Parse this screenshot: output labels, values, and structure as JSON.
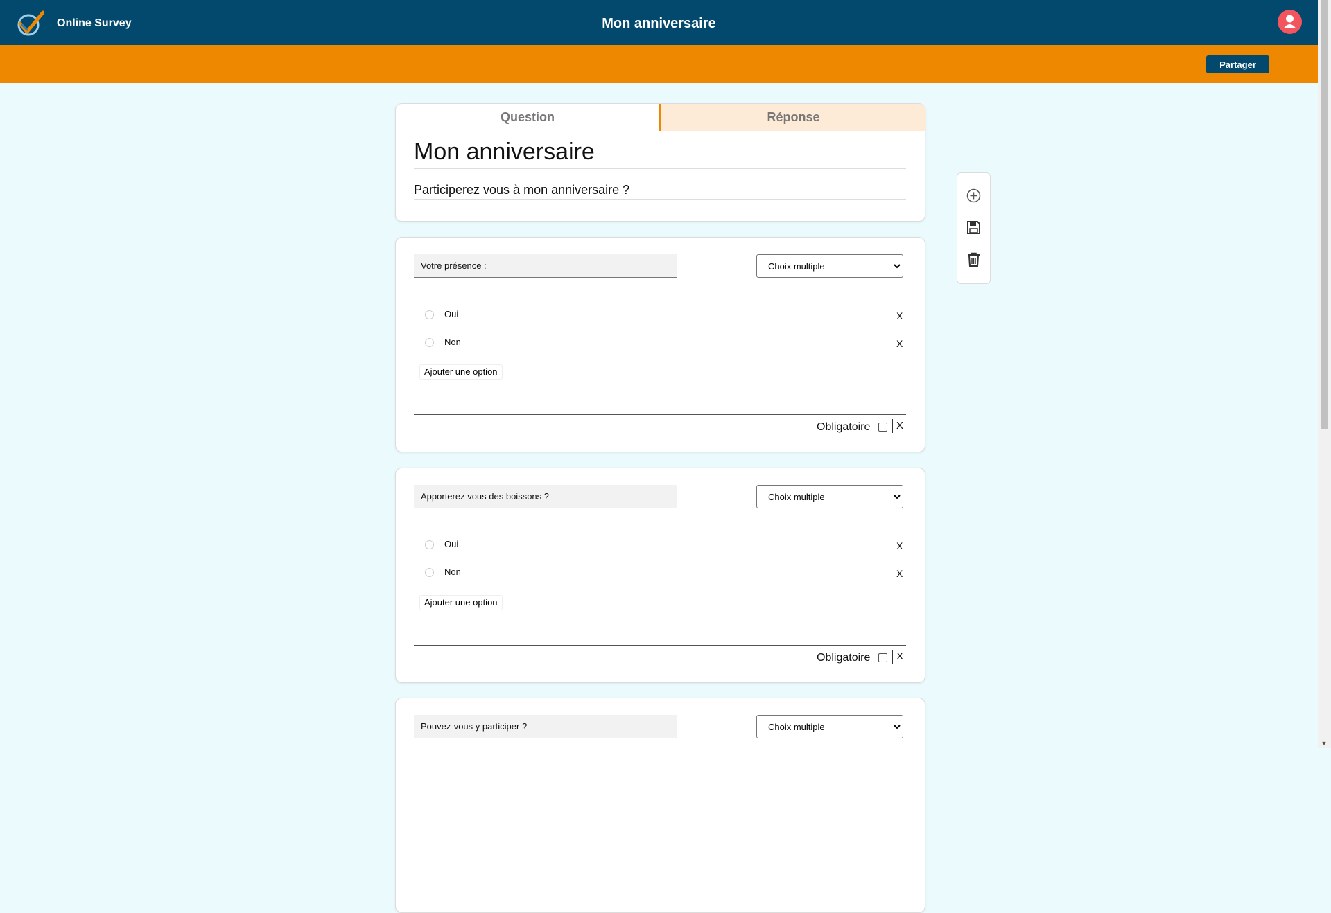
{
  "header": {
    "brand": "Online Survey",
    "title": "Mon anniversaire",
    "user_icon": "user-icon",
    "brand_colors": {
      "navy": "#03496e",
      "orange": "#ee8800",
      "avatar": "#f2555d"
    }
  },
  "actions": {
    "share_label": "Partager"
  },
  "tabs": {
    "question": "Question",
    "answer": "Réponse"
  },
  "survey": {
    "title": "Mon anniversaire",
    "description": "Participerez vous à mon anniversaire ?"
  },
  "toolbar": {
    "icons": [
      "add-circle-icon",
      "save-icon",
      "trash-icon"
    ]
  },
  "questions": [
    {
      "title": "Votre présence :",
      "type": "Choix multiple",
      "options": [
        {
          "label": "Oui",
          "remove": "X"
        },
        {
          "label": "Non",
          "remove": "X"
        }
      ],
      "add_option_label": "Ajouter une option",
      "required_label": "Obligatoire",
      "remove": "X"
    },
    {
      "title": "Apporterez vous des boissons ?",
      "type": "Choix multiple",
      "options": [
        {
          "label": "Oui",
          "remove": "X"
        },
        {
          "label": "Non",
          "remove": "X"
        }
      ],
      "add_option_label": "Ajouter une option",
      "required_label": "Obligatoire",
      "remove": "X"
    },
    {
      "title": "Pouvez-vous y participer ?",
      "type": "Choix multiple"
    }
  ]
}
